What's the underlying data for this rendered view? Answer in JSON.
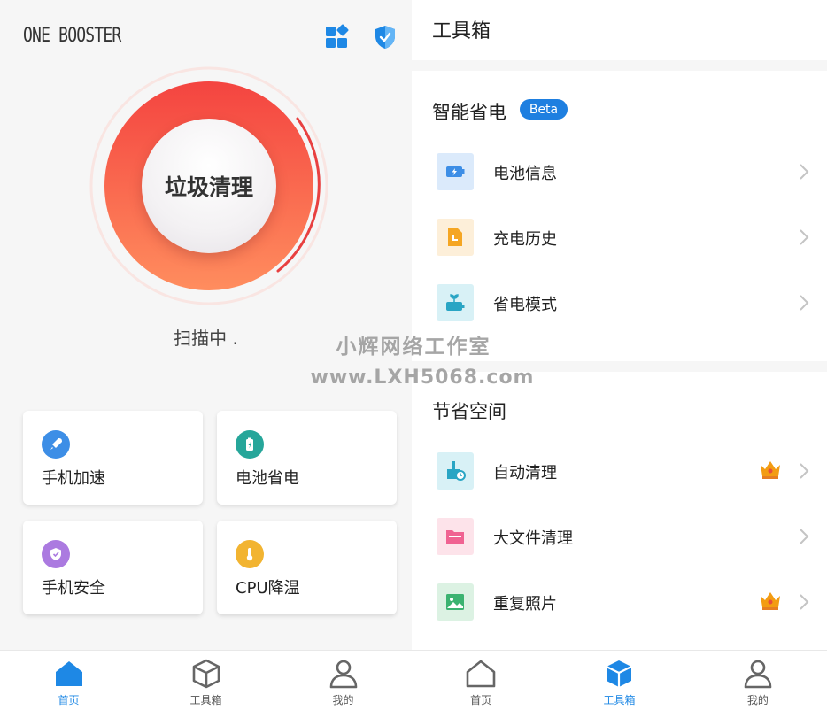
{
  "left": {
    "app_title": "ONE BOOSTER",
    "ring_label": "垃圾清理",
    "status": "扫描中 .",
    "cards": [
      {
        "label": "手机加速",
        "icon": "rocket-icon",
        "color": "#3d8ee6"
      },
      {
        "label": "电池省电",
        "icon": "battery-icon",
        "color": "#26a69a"
      },
      {
        "label": "手机安全",
        "icon": "shield-icon",
        "color": "#ab7ae0"
      },
      {
        "label": "CPU降温",
        "icon": "thermometer-icon",
        "color": "#f2b431"
      }
    ],
    "tabs": [
      {
        "label": "首页",
        "active": true
      },
      {
        "label": "工具箱",
        "active": false
      },
      {
        "label": "我的",
        "active": false
      }
    ]
  },
  "right": {
    "header": "工具箱",
    "sections": [
      {
        "title": "智能省电",
        "badge": "Beta",
        "items": [
          {
            "label": "电池信息",
            "icon": "battery-info-icon"
          },
          {
            "label": "充电历史",
            "icon": "charge-history-icon"
          },
          {
            "label": "省电模式",
            "icon": "power-saving-icon"
          }
        ]
      },
      {
        "title": "节省空间",
        "items": [
          {
            "label": "自动清理",
            "icon": "auto-clean-icon",
            "premium": true
          },
          {
            "label": "大文件清理",
            "icon": "folder-icon",
            "premium": false
          },
          {
            "label": "重复照片",
            "icon": "photo-icon",
            "premium": true
          }
        ]
      }
    ],
    "tabs": [
      {
        "label": "首页",
        "active": false
      },
      {
        "label": "工具箱",
        "active": true
      },
      {
        "label": "我的",
        "active": false
      }
    ]
  },
  "watermark": {
    "line1": "小辉网络工作室",
    "line2": "www.LXH5068.com"
  },
  "colors": {
    "accent": "#1e88e5",
    "ring_top": "#f44a43",
    "ring_bottom": "#ff8a5c"
  }
}
